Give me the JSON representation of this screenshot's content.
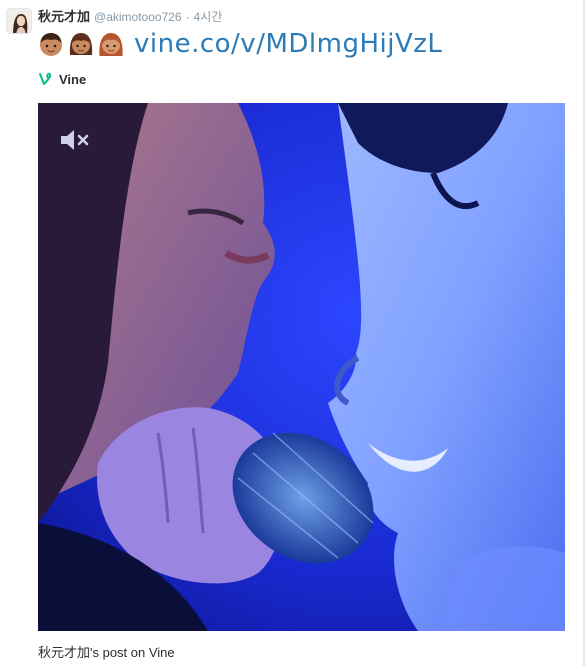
{
  "tweet": {
    "display_name": "秋元才加",
    "handle": "@akimotooo726",
    "separator": "·",
    "time": "4시간",
    "emojis": [
      "boy-emoji",
      "girl-emoji",
      "woman-emoji"
    ],
    "link_text": "vine.co/v/MDlmgHijVzL"
  },
  "card": {
    "source_label": "Vine",
    "title": "秋元才加's post on Vine",
    "video_muted": true
  },
  "colors": {
    "link": "#2b7bb9",
    "vine_green": "#00bf8f",
    "video_blue": "#1c2fd0",
    "muted_text": "#8899a6"
  }
}
